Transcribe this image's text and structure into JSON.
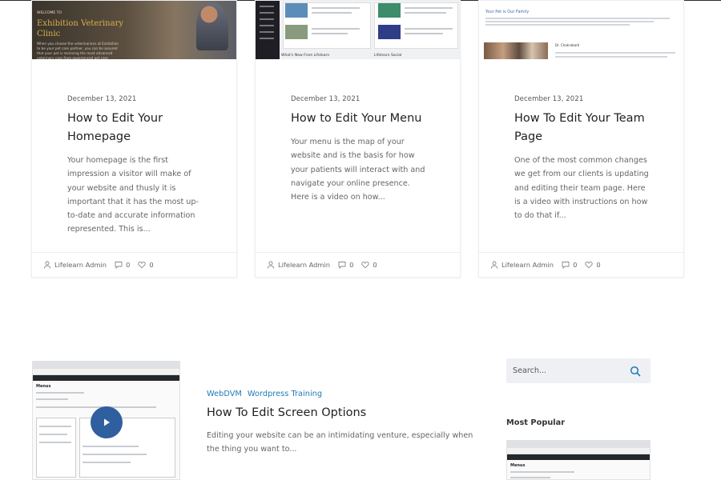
{
  "cards": [
    {
      "thumb": {
        "welcome": "WELCOME TO",
        "name": "Exhibition Veterinary Clinic",
        "text": "When you choose the veterinarians at Exhibition to be your pet care partner, you can be assured that your pet is receiving the most advanced veterinary care from experienced pet care professionals."
      },
      "date": "December 13, 2021",
      "title": "How to Edit Your Homepage",
      "excerpt": "Your homepage is the first impression a visitor will make of your website and thusly it is important that it has the most up-to-date and accurate information represented. This is...",
      "author": "Lifelearn Admin",
      "comments": "0",
      "likes": "0"
    },
    {
      "thumb": {
        "caption_left": "What's New From Lifelearn",
        "caption_right": "Lifelearn Social"
      },
      "date": "December 13, 2021",
      "title": "How to Edit Your Menu",
      "excerpt": "Your menu is the map of your website and is the basis for how your patients will interact with and navigate your online presence. Here is a video on how...",
      "author": "Lifelearn Admin",
      "comments": "0",
      "likes": "0"
    },
    {
      "thumb": {
        "heading": "Your Pet is Our Family",
        "doctor": "Dr. Chakrabarti"
      },
      "date": "December 13, 2021",
      "title": "How To Edit Your Team Page",
      "excerpt": "One of the most common changes we get from our clients is updating and editing their team page. Here is a video with instructions on how to do that if...",
      "author": "Lifelearn Admin",
      "comments": "0",
      "likes": "0"
    }
  ],
  "post": {
    "categories": [
      "WebDVM",
      "Wordpress Training"
    ],
    "title": "How To Edit Screen Options",
    "excerpt": "Editing your website can be an intimidating venture, especially when the thing you want to...",
    "thumb_heading": "Menus"
  },
  "sidebar": {
    "search_placeholder": "Search...",
    "widget_title": "Most Popular"
  },
  "colors": {
    "link": "#1f7ab8",
    "play_button": "#2f5f9e",
    "search_icon": "#1f7ab8"
  },
  "icons": [
    "user-icon",
    "comment-icon",
    "heart-icon",
    "play-icon",
    "search-icon"
  ]
}
